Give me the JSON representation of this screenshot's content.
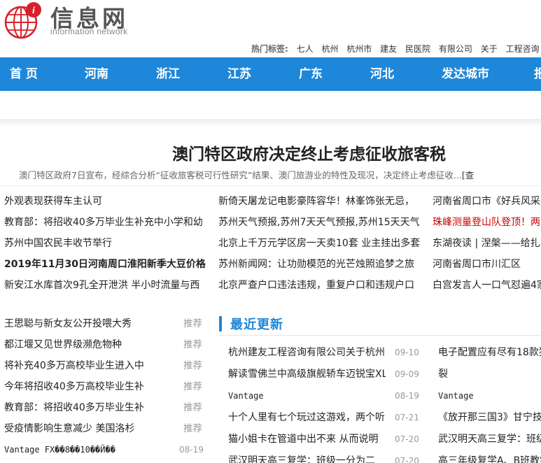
{
  "logo": {
    "title": "信息网",
    "subtitle": "information network"
  },
  "hot_tags": {
    "label": "热门标签:",
    "tags": [
      "七人",
      "杭州",
      "杭州市",
      "建友",
      "民医院",
      "有限公司",
      "关于",
      "工程咨询"
    ]
  },
  "nav": [
    "首 页",
    "河南",
    "浙江",
    "江苏",
    "广东",
    "河北",
    "发达城市",
    "报"
  ],
  "headline": {
    "title": "澳门特区政府决定终止考虑征收旅客税",
    "summary": "澳门特区政府7日宣布，经综合分析“征收旅客税可行性研究”结果、澳门旅游业的特性及现况，决定终止考虑征收...",
    "more": "[查"
  },
  "news_col1": [
    "外观表现获得车主认可",
    "教育部：将招收40多万毕业生补充中小学和幼",
    "苏州中国农民丰收节举行",
    "2019年11月30日河南周口淮阳新季大豆价格",
    "新安江水库首次9孔全开泄洪 半小时流量与西"
  ],
  "news_col2": [
    "新倚天屠龙记电影豪阵容华！林峯饰张无忌，",
    "苏州天气预报,苏州7天天气预报,苏州15天天气",
    "北京上千万元学区房一天卖10套 业主挂出多套",
    "苏州新闻网：让功勋模范的光芒烛照追梦之旅",
    "北京严查户口违法违规，重复户口和违规户口"
  ],
  "news_col3": [
    "河南省周口市《好兵风采",
    "珠峰测量登山队登顶！两",
    "东湖夜读 | 涅槃——给扎",
    "河南省周口市川汇区",
    "白宫发言人一口气怼遍4家"
  ],
  "recommended": [
    {
      "title": "王思聪与新女友公开投喂大秀",
      "tag": "推荐"
    },
    {
      "title": "都江堰又见世界级濒危物种",
      "tag": "推荐"
    },
    {
      "title": "将补充40多万高校毕业生进入中",
      "tag": "推荐"
    },
    {
      "title": "今年将招收40多万高校毕业生补",
      "tag": "推荐"
    },
    {
      "title": "教育部：将招收40多万毕业生补",
      "tag": "推荐"
    },
    {
      "title": "受疫情影响生意减少 美国洛杉",
      "tag": "推荐"
    },
    {
      "title": "Vantage FX��8��10��Й��",
      "tag": "08-19"
    }
  ],
  "latest": {
    "title": "最近更新",
    "left": [
      {
        "title": "杭州建友工程咨询有限公司关于杭州",
        "date": "09-10"
      },
      {
        "title": "解读雪佛兰中高级旗舰轿车迈锐宝XL",
        "date": "09-09"
      },
      {
        "title": "Vantage",
        "date": "08-19"
      },
      {
        "title": "十个人里有七个玩过这游戏，两个听",
        "date": "07-21"
      },
      {
        "title": "猫小姐卡在管道中出不来 从而说明",
        "date": "07-20"
      },
      {
        "title": "武汉明天高三复学：班级一分为二",
        "date": "07-20"
      }
    ],
    "right": [
      "电子配置应有尽有18款独",
      "裂",
      "Vantage",
      "《放开那三国3》甘宁技",
      "武汉明天高三复学：班级",
      "高三年级复学A、B班教学"
    ]
  },
  "colors": {
    "nav_bg": "#1e87d9",
    "accent": "#1e87d9",
    "logo_red": "#d8202a",
    "highlight_red": "#cc0000"
  }
}
